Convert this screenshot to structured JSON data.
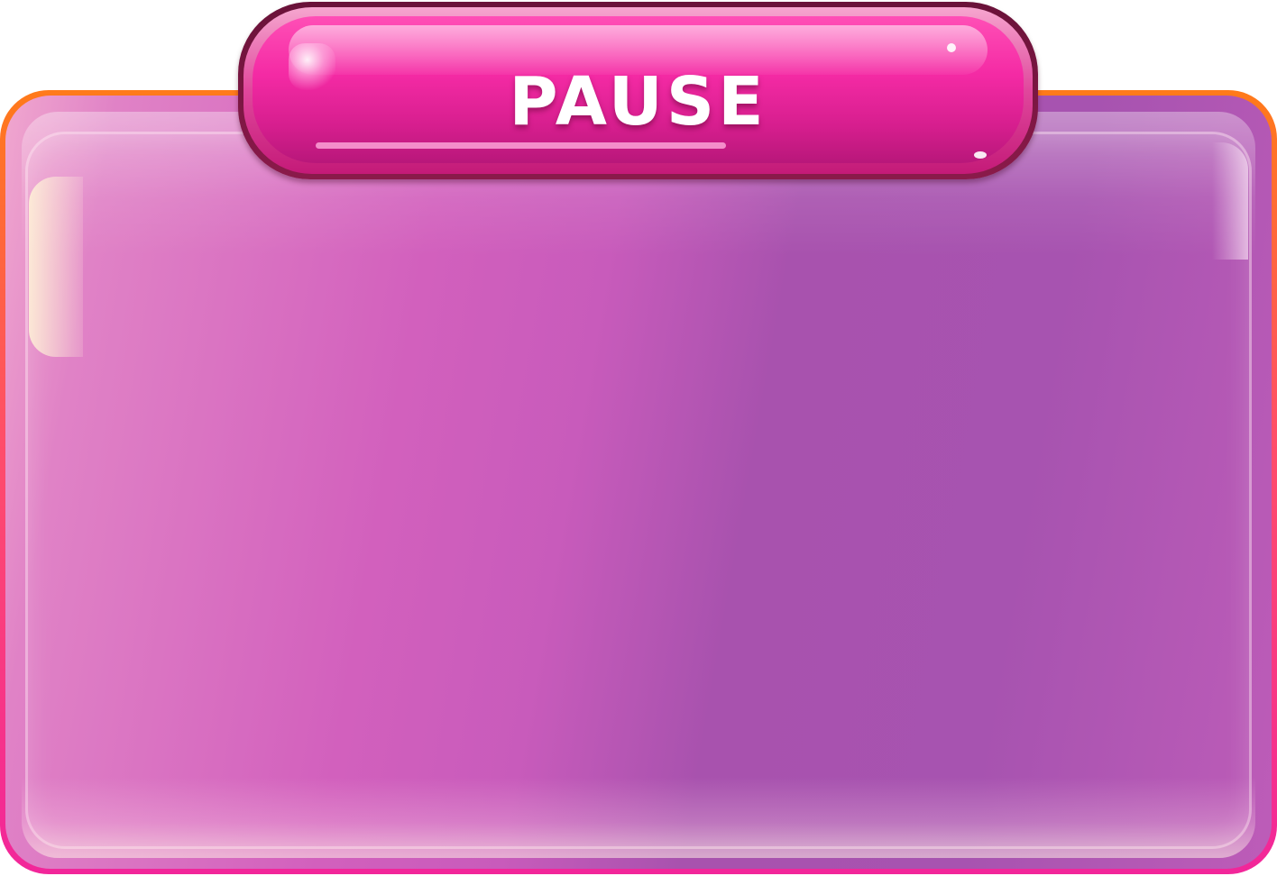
{
  "pause_menu": {
    "title": "PAUSE"
  },
  "colors": {
    "frame_gradient_top": "#ff7a1a",
    "frame_gradient_bottom": "#f2269a",
    "panel_purple": "#a852ae",
    "panel_pink": "#d260bd",
    "title_pink": "#f42aa4",
    "title_text": "#ffffff"
  }
}
